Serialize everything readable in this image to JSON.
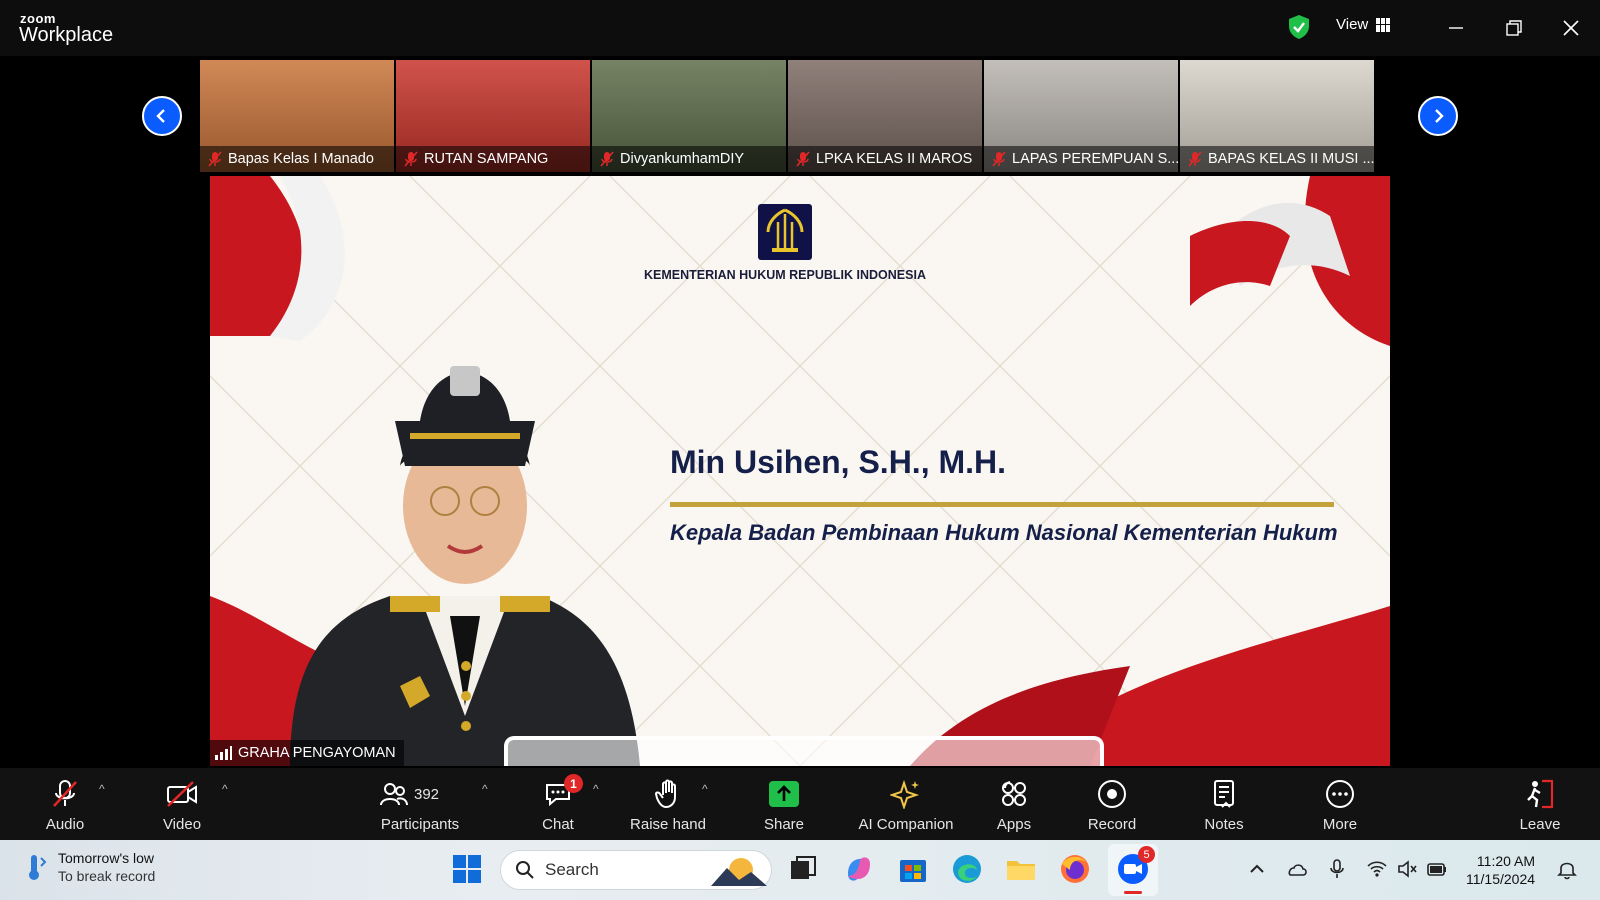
{
  "app": {
    "logo_top": "zoom",
    "logo_bottom": "Workplace",
    "view_label": "View"
  },
  "colors": {
    "accent": "#0b5cff",
    "mute_red": "#e02828",
    "gold": "#c3a23c",
    "navy": "#15204a",
    "shield_green": "#1fbf4a"
  },
  "gallery": {
    "tiles": [
      {
        "name": "Bapas Kelas I Manado",
        "muted": true,
        "bg": "#c9743a"
      },
      {
        "name": "RUTAN SAMPANG",
        "muted": true,
        "bg": "#c8352c"
      },
      {
        "name": "DivyankumhamDIY",
        "muted": true,
        "bg": "#5e6e4a"
      },
      {
        "name": "LPKA KELAS II MAROS",
        "muted": true,
        "bg": "#7c6a63"
      },
      {
        "name": "LAPAS PEREMPUAN S...",
        "muted": true,
        "bg": "#b8b3ae"
      },
      {
        "name": "BAPAS KELAS II MUSI ...",
        "muted": true,
        "bg": "#d7d2c8"
      }
    ]
  },
  "slide": {
    "ministry": "KEMENTERIAN HUKUM REPUBLIK INDONESIA",
    "name": "Min Usihen, S.H., M.H.",
    "role": "Kepala Badan Pembinaan Hukum Nasional Kementerian Hukum",
    "speaker": "GRAHA PENGAYOMAN"
  },
  "toolbar": {
    "audio": "Audio",
    "video": "Video",
    "participants": "Participants",
    "participants_count": "392",
    "chat": "Chat",
    "chat_badge": "1",
    "raise_hand": "Raise hand",
    "share": "Share",
    "ai_companion": "AI Companion",
    "apps": "Apps",
    "record": "Record",
    "notes": "Notes",
    "more": "More",
    "leave": "Leave"
  },
  "taskbar": {
    "weather_line1": "Tomorrow's low",
    "weather_line2": "To break record",
    "search_placeholder": "Search",
    "zoom_badge": "5",
    "time": "11:20 AM",
    "date": "11/15/2024"
  }
}
